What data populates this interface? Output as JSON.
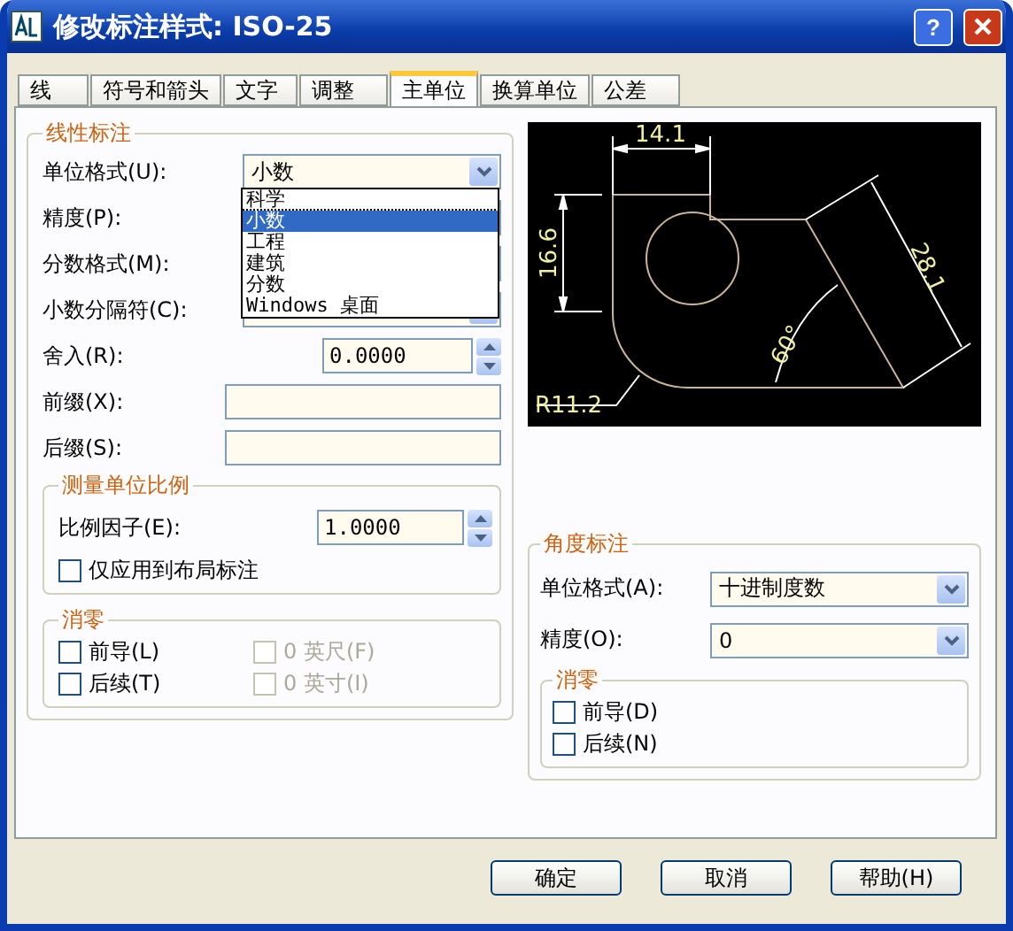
{
  "window": {
    "title": "修改标注样式: ISO-25",
    "help_button": "?"
  },
  "tabs": [
    {
      "label": "线",
      "selected": false
    },
    {
      "label": "符号和箭头",
      "selected": false
    },
    {
      "label": "文字",
      "selected": false
    },
    {
      "label": "调整",
      "selected": false
    },
    {
      "label": "主单位",
      "selected": true
    },
    {
      "label": "换算单位",
      "selected": false
    },
    {
      "label": "公差",
      "selected": false
    }
  ],
  "linear": {
    "title": "线性标注",
    "unit_format": {
      "label": "单位格式(U):",
      "value": "小数",
      "expanded": true,
      "options": [
        {
          "label": "科学",
          "selected": false
        },
        {
          "label": "小数",
          "selected": true
        },
        {
          "label": "工程",
          "selected": false
        },
        {
          "label": "建筑",
          "selected": false
        },
        {
          "label": "分数",
          "selected": false
        },
        {
          "label": "Windows 桌面",
          "selected": false
        }
      ]
    },
    "rows": [
      {
        "label": "精度(P):",
        "kind": "combo"
      },
      {
        "label": "分数格式(M):",
        "kind": "combo"
      },
      {
        "label": "小数分隔符(C):",
        "kind": "combo"
      },
      {
        "label": "舍入(R):",
        "kind": "spin",
        "value": "0.0000"
      },
      {
        "label": "前缀(X):",
        "kind": "text"
      },
      {
        "label": "后缀(S):",
        "kind": "text"
      }
    ],
    "scale": {
      "title": "测量单位比例",
      "factor_label": "比例因子(E):",
      "factor": "1.0000",
      "layout_only": {
        "label": "仅应用到布局标注",
        "checked": false
      }
    },
    "zero": {
      "title": "消零",
      "options": [
        {
          "label": "前导(L)",
          "checked": false,
          "disabled": false
        },
        {
          "label": "0 英尺(F)",
          "checked": false,
          "disabled": true
        },
        {
          "label": "后续(T)",
          "checked": false,
          "disabled": false
        },
        {
          "label": "0 英寸(I)",
          "checked": false,
          "disabled": true
        }
      ]
    }
  },
  "preview": {
    "labels": [
      "14.1",
      "16.6",
      "28.1",
      "60°",
      "R11.2"
    ]
  },
  "angular": {
    "title": "角度标注",
    "unit_format": {
      "label": "单位格式(A):",
      "value": "十进制度数"
    },
    "precision": {
      "label": "精度(O):",
      "value": "0"
    },
    "zero": {
      "title": "消零",
      "options": [
        {
          "label": "前导(D)",
          "checked": false
        },
        {
          "label": "后续(N)",
          "checked": false
        }
      ]
    }
  },
  "buttons": [
    "确定",
    "取消",
    "帮助(H)"
  ]
}
